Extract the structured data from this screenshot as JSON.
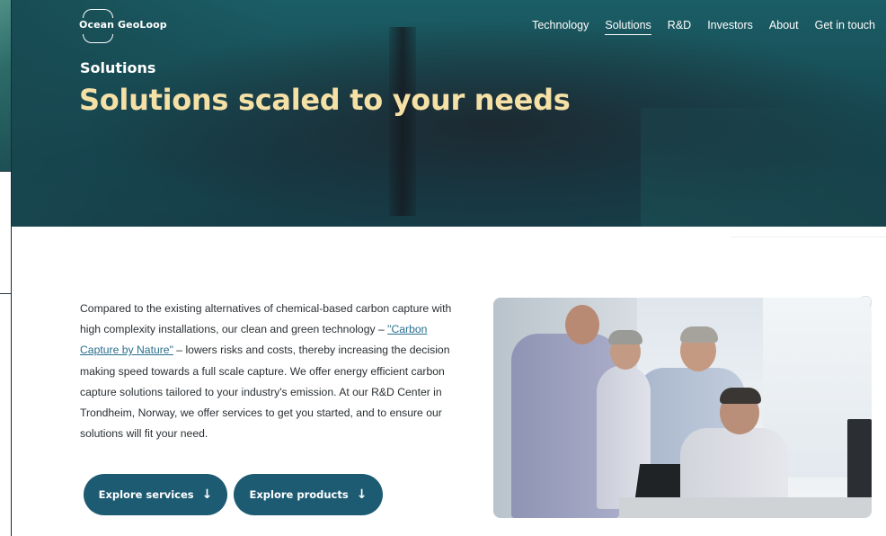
{
  "brand": {
    "name": "Ocean GeoLoop"
  },
  "nav": {
    "items": [
      {
        "label": "Technology",
        "active": false
      },
      {
        "label": "Solutions",
        "active": true
      },
      {
        "label": "R&D",
        "active": false
      },
      {
        "label": "Investors",
        "active": false
      },
      {
        "label": "About",
        "active": false
      },
      {
        "label": "Get in touch",
        "active": false
      }
    ]
  },
  "hero": {
    "breadcrumb": "Solutions",
    "title": "Solutions scaled to your needs"
  },
  "intro": {
    "part1": "Compared to the existing alternatives of chemical-based carbon capture with high complexity installations, our clean and green technology – ",
    "link": "\"Carbon Capture by Nature\"",
    "part2": " – lowers risks and costs, thereby increasing the decision making speed towards a full scale capture. We offer energy efficient carbon capture solutions tailored to your industry's emission. At our R&D Center in Trondheim, Norway, we offer services to get you started, and to ensure our solutions will fit your need."
  },
  "buttons": {
    "services": "Explore services",
    "products": "Explore products",
    "arrow_icon": "arrow-down-icon"
  },
  "colors": {
    "hero_title": "#f5e0a6",
    "button_bg": "#1d5b72",
    "link": "#2a6f8f"
  }
}
